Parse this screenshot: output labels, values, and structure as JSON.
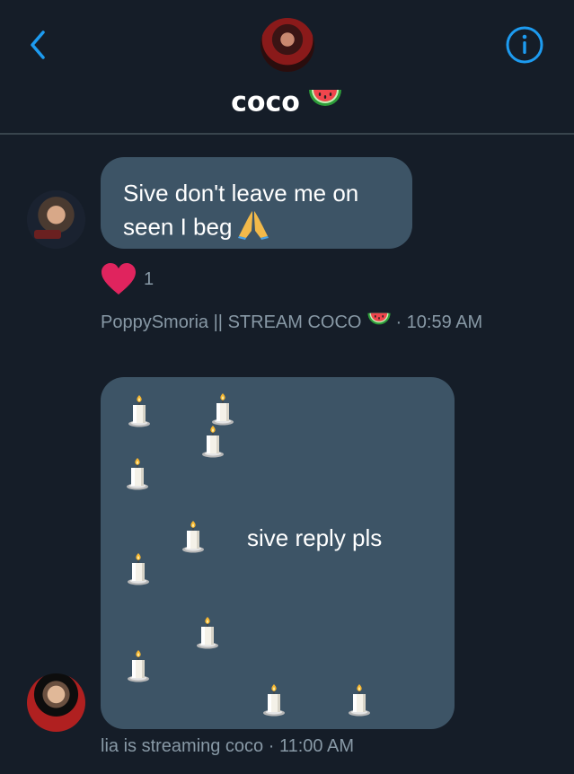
{
  "header": {
    "title": "coco",
    "back_icon": "chevron-left-icon",
    "info_icon": "info-icon",
    "title_emoji": "watermelon-icon",
    "accent": "#1d9bf0"
  },
  "messages": [
    {
      "text": "Sive don't leave me on seen I beg",
      "emoji": "folded-hands-icon",
      "reaction": {
        "icon": "heart-icon",
        "count": "1"
      },
      "sender": "PoppySmoria || STREAM COCO",
      "sender_emoji": "watermelon-icon",
      "time": "· 10:59 AM"
    },
    {
      "text": "sive reply pls",
      "decoration": "candle-icon",
      "sender": "lia is streaming coco",
      "time": "· 11:00 AM"
    }
  ],
  "colors": {
    "background": "#151d28",
    "bubble": "#3d5466",
    "meta_text": "#8899a6",
    "heart": "#e0245e"
  }
}
